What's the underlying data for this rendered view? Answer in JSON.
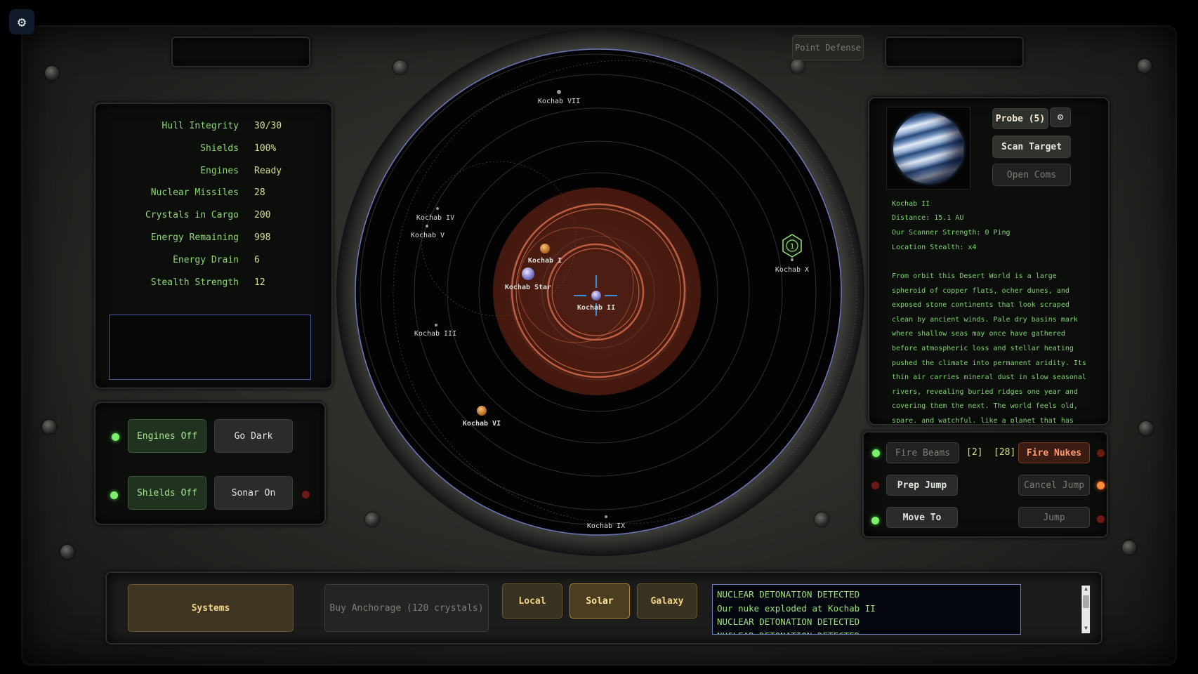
{
  "settings": {
    "icon": "gear-icon"
  },
  "top": {
    "point_defense_label": "Point Defense"
  },
  "status": {
    "rows": [
      {
        "label": "Hull Integrity",
        "value": "30/30"
      },
      {
        "label": "Shields",
        "value": "100%"
      },
      {
        "label": "Engines",
        "value": "Ready"
      },
      {
        "label": "Nuclear Missiles",
        "value": "28"
      },
      {
        "label": "Crystals in Cargo",
        "value": "200"
      },
      {
        "label": "Energy Remaining",
        "value": "998"
      },
      {
        "label": "Energy Drain",
        "value": "6"
      },
      {
        "label": "Stealth Strength",
        "value": "12"
      }
    ]
  },
  "controls": {
    "engines_off": "Engines Off",
    "go_dark": "Go Dark",
    "shields_off": "Shields Off",
    "sonar_on": "Sonar On"
  },
  "map": {
    "planets": {
      "kochab_vii": "Kochab VII",
      "kochab_iv": "Kochab IV",
      "kochab_v": "Kochab V",
      "kochab_i": "Kochab I",
      "kochab_star": "Kochab Star",
      "kochab_ii": "Kochab II",
      "kochab_iii": "Kochab III",
      "kochab_vi": "Kochab VI",
      "kochab_x": "Kochab X",
      "kochab_ix": "Kochab IX"
    },
    "marker_number": "1"
  },
  "target": {
    "probe_label": "Probe (5)",
    "scan_target": "Scan Target",
    "open_coms": "Open Coms",
    "name": "Kochab II",
    "distance": "Distance: 15.1 AU",
    "scanner_strength": "Our Scanner Strength: 0 Ping",
    "location_stealth": "Location Stealth: x4",
    "description": "From orbit this Desert World is a large spheroid of copper flats, ocher dunes, and exposed stone continents that look scraped clean by ancient winds. Pale dry basins mark where shallow seas may once have gathered before atmospheric loss and stellar heating pushed the climate into permanent aridity. Its thin air carries mineral dust in slow seasonal rivers, revealing buried ridges one year and covering them the next. The world feels old, spare, and watchful, like a planet that has forgotten water but kept every shoreline as a"
  },
  "weapons": {
    "fire_beams": "Fire Beams",
    "beam_count": "[2]",
    "nuke_count": "[28]",
    "fire_nukes": "Fire Nukes",
    "prep_jump": "Prep Jump",
    "cancel_jump": "Cancel Jump",
    "move_to": "Move To",
    "jump": "Jump"
  },
  "bottom": {
    "systems": "Systems",
    "buy_anchorage": "Buy Anchorage (120 crystals)",
    "local": "Local",
    "solar": "Solar",
    "galaxy": "Galaxy"
  },
  "log": {
    "lines": [
      "NUCLEAR DETONATION DETECTED",
      "Our nuke exploded at Kochab II",
      "NUCLEAR DETONATION DETECTED",
      "NUCLEAR DETONATION DETECTED"
    ]
  },
  "colors": {
    "accent_green": "#8fd673",
    "alert_orange": "#ff8a3a",
    "scan_ring": "#d06a4a"
  }
}
